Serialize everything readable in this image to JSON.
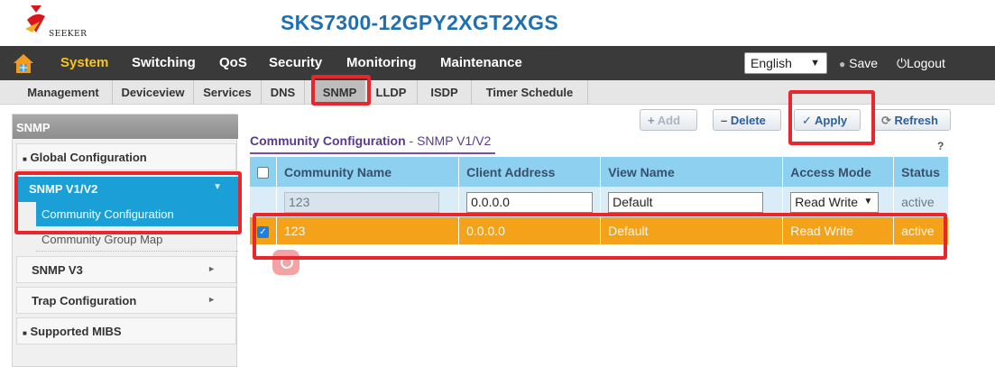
{
  "header": {
    "logo_text": "SEEKER",
    "product_title": "SKS7300-12GPY2XGT2XGS"
  },
  "main_menu": {
    "items": [
      "System",
      "Switching",
      "QoS",
      "Security",
      "Monitoring",
      "Maintenance"
    ],
    "active": "System",
    "language": "English",
    "save_label": "Save",
    "logout_label": "Logout"
  },
  "sub_menu": {
    "items": [
      "Management",
      "Deviceview",
      "Services",
      "DNS",
      "SNMP",
      "LLDP",
      "ISDP",
      "Timer Schedule"
    ],
    "active": "SNMP"
  },
  "left_nav": {
    "title": "SNMP",
    "global_config": "Global Configuration",
    "snmp_v1v2": "SNMP V1/V2",
    "community_configuration": "Community Configuration",
    "community_group_map": "Community Group Map",
    "snmp_v3": "SNMP V3",
    "trap_configuration": "Trap Configuration",
    "supported_mibs": "Supported MIBS"
  },
  "toolbar": {
    "add_label": "Add",
    "delete_label": "Delete",
    "apply_label": "Apply",
    "refresh_label": "Refresh"
  },
  "section": {
    "title": "Community Configuration",
    "subtitle": "- SNMP V1/V2",
    "help": "?"
  },
  "table": {
    "columns": [
      "Community Name",
      "Client Address",
      "View Name",
      "Access Mode",
      "Status"
    ],
    "edit_row": {
      "community_name": "123",
      "client_address": "0.0.0.0",
      "view_name": "Default",
      "access_mode": "Read Write",
      "status": "active"
    },
    "rows": [
      {
        "community_name": "123",
        "client_address": "0.0.0.0",
        "view_name": "Default",
        "access_mode": "Read Write",
        "status": "active",
        "checked": true
      }
    ]
  },
  "colors": {
    "title_blue": "#1f6fb3",
    "menu_bar": "#3a3a3a",
    "active_menu": "#f7c520",
    "nav_active": "#1a9fd6",
    "table_header": "#8dd0f0",
    "selected_row": "#f4a21a",
    "annotation_red": "#e8262b"
  }
}
